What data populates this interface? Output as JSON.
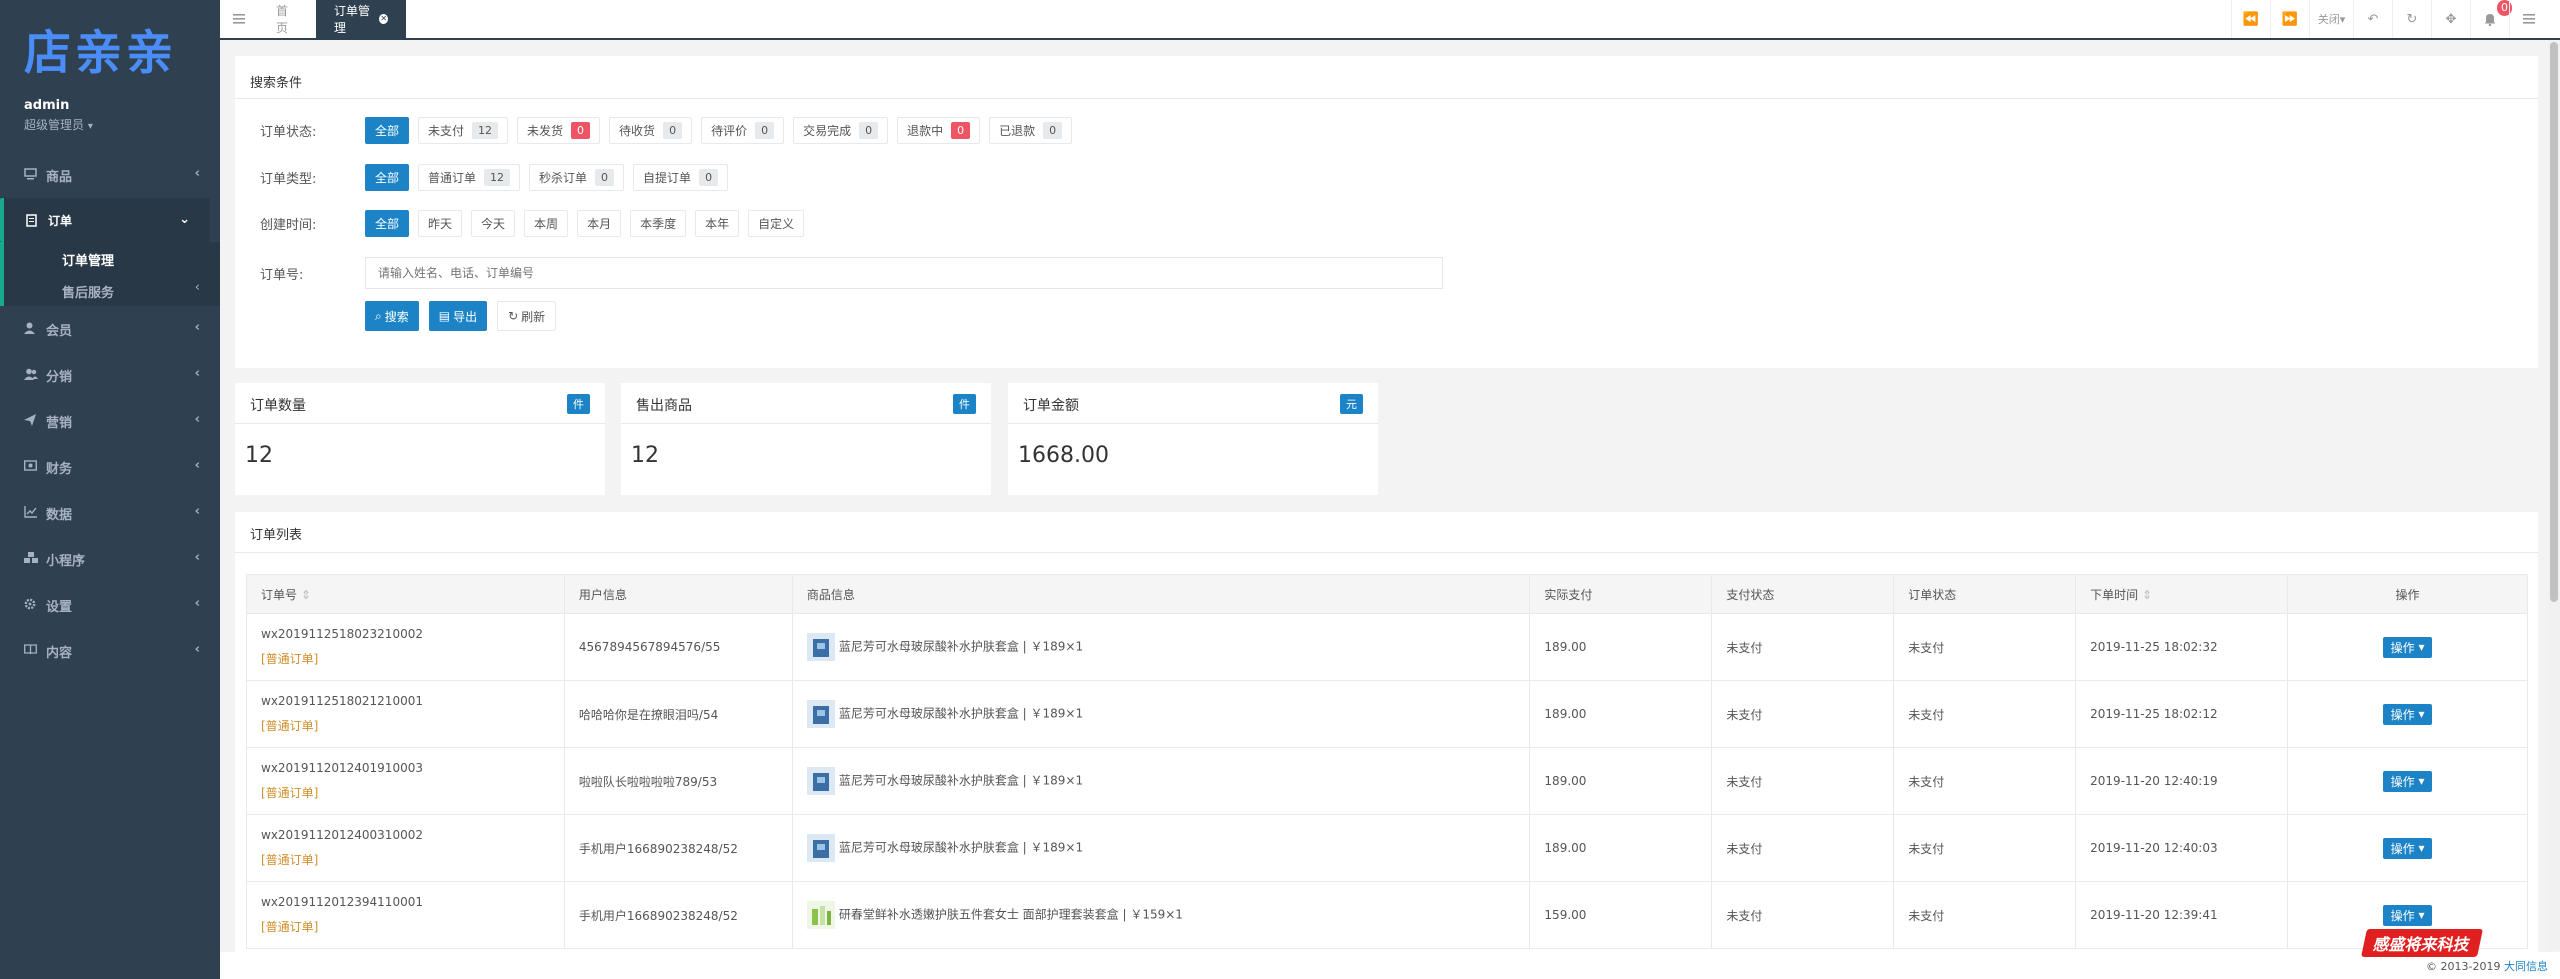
{
  "sidebar": {
    "logo": "店亲亲",
    "user": "admin",
    "role": "超级管理员",
    "items": [
      {
        "label": "商品",
        "icon": "monitor-icon"
      },
      {
        "label": "订单",
        "icon": "doc-icon"
      },
      {
        "label": "会员",
        "icon": "user-icon"
      },
      {
        "label": "分销",
        "icon": "users-icon"
      },
      {
        "label": "营销",
        "icon": "send-icon"
      },
      {
        "label": "财务",
        "icon": "money-icon"
      },
      {
        "label": "数据",
        "icon": "chart-icon"
      },
      {
        "label": "小程序",
        "icon": "cubes-icon"
      },
      {
        "label": "设置",
        "icon": "gear-icon"
      },
      {
        "label": "内容",
        "icon": "book-icon"
      }
    ],
    "sub": [
      "订单管理",
      "售后服务"
    ]
  },
  "topbar": {
    "tabs": [
      "首页",
      "订单管理"
    ],
    "close_label": "关闭",
    "notify_count": "0"
  },
  "search": {
    "title": "搜索条件",
    "status_label": "订单状态:",
    "status": [
      {
        "label": "全部"
      },
      {
        "label": "未支付",
        "count": "12"
      },
      {
        "label": "未发货",
        "count": "0"
      },
      {
        "label": "待收货",
        "count": "0"
      },
      {
        "label": "待评价",
        "count": "0"
      },
      {
        "label": "交易完成",
        "count": "0"
      },
      {
        "label": "退款中",
        "count": "0"
      },
      {
        "label": "已退款",
        "count": "0"
      }
    ],
    "type_label": "订单类型:",
    "types": [
      {
        "label": "全部"
      },
      {
        "label": "普通订单",
        "count": "12"
      },
      {
        "label": "秒杀订单",
        "count": "0"
      },
      {
        "label": "自提订单",
        "count": "0"
      }
    ],
    "time_label": "创建时间:",
    "times": [
      "全部",
      "昨天",
      "今天",
      "本周",
      "本月",
      "本季度",
      "本年",
      "自定义"
    ],
    "no_label": "订单号:",
    "placeholder": "请输入姓名、电话、订单编号",
    "btn_search": "搜索",
    "btn_export": "导出",
    "btn_refresh": "刷新"
  },
  "stats": [
    {
      "title": "订单数量",
      "unit": "件",
      "value": "12"
    },
    {
      "title": "售出商品",
      "unit": "件",
      "value": "12"
    },
    {
      "title": "订单金额",
      "unit": "元",
      "value": "1668.00"
    }
  ],
  "list": {
    "title": "订单列表",
    "headers": [
      "订单号",
      "用户信息",
      "商品信息",
      "实际支付",
      "支付状态",
      "订单状态",
      "下单时间",
      "操作"
    ],
    "rows": [
      {
        "no": "wx2019112518023210002",
        "type": "[普通订单]",
        "user": "4567894567894576/55",
        "product": "蓝尼芳可水母玻尿酸补水护肤套盒 | ￥189×1",
        "pay": "189.00",
        "pay_status": "未支付",
        "status": "未支付",
        "time": "2019-11-25 18:02:32",
        "op": "操作"
      },
      {
        "no": "wx2019112518021210001",
        "type": "[普通订单]",
        "user": "哈哈哈你是在撩眼泪吗/54",
        "product": "蓝尼芳可水母玻尿酸补水护肤套盒 | ￥189×1",
        "pay": "189.00",
        "pay_status": "未支付",
        "status": "未支付",
        "time": "2019-11-25 18:02:12",
        "op": "操作"
      },
      {
        "no": "wx2019112012401910003",
        "type": "[普通订单]",
        "user": "啦啦队长啦啦啦啦789/53",
        "product": "蓝尼芳可水母玻尿酸补水护肤套盒 | ￥189×1",
        "pay": "189.00",
        "pay_status": "未支付",
        "status": "未支付",
        "time": "2019-11-20 12:40:19",
        "op": "操作"
      },
      {
        "no": "wx2019112012400310002",
        "type": "[普通订单]",
        "user": "手机用户166890238248/52",
        "product": "蓝尼芳可水母玻尿酸补水护肤套盒 | ￥189×1",
        "pay": "189.00",
        "pay_status": "未支付",
        "status": "未支付",
        "time": "2019-11-20 12:40:03",
        "op": "操作"
      },
      {
        "no": "wx2019112012394110001",
        "type": "[普通订单]",
        "user": "手机用户166890238248/52",
        "product": "研春堂鲜补水透嫩护肤五件套女士 面部护理套装套盒 | ￥159×1",
        "pay": "159.00",
        "pay_status": "未支付",
        "status": "未支付",
        "time": "2019-11-20 12:39:41",
        "op": "操作"
      }
    ]
  },
  "footer": {
    "copyright": "© 2013-2019",
    "company": "大同信息",
    "watermark": "感盛将来科技"
  },
  "colors": {
    "sidebar": "#2f4050",
    "primary": "#1c84c6",
    "danger": "#ed5565",
    "accent": "#19aa8d"
  }
}
